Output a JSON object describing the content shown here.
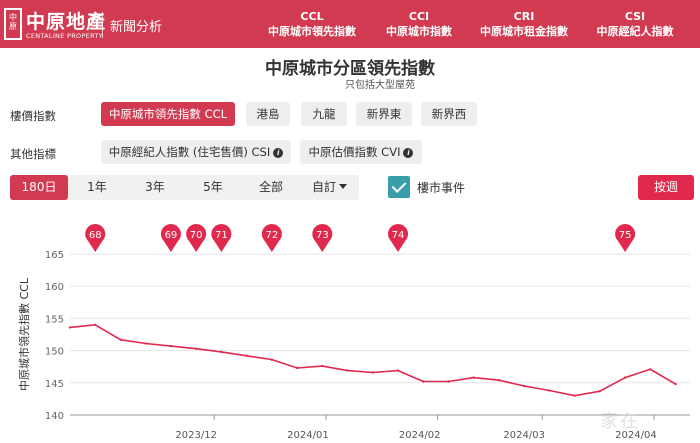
{
  "header": {
    "logo_mark": "中原",
    "logo_name": "中原地產",
    "logo_sub": "CENTALINE PROPERTY",
    "news_link": "新聞分析",
    "nav": [
      {
        "code": "CCL",
        "name": "中原城市領先指數"
      },
      {
        "code": "CCI",
        "name": "中原城市指數"
      },
      {
        "code": "CRI",
        "name": "中原城市租金指數"
      },
      {
        "code": "CSI",
        "name": "中原經紀人指數"
      }
    ]
  },
  "title": "中原城市分區領先指數",
  "subtitle": "只包括大型屋苑",
  "price_index": {
    "label": "樓價指數",
    "options": [
      "中原城市領先指數 CCL",
      "港島",
      "九龍",
      "新界東",
      "新界西"
    ],
    "selected": "中原城市領先指數 CCL"
  },
  "other_index": {
    "label": "其他指標",
    "options": [
      "中原經紀人指數 (住宅售價) CSI",
      "中原估價指數 CVI"
    ]
  },
  "range": {
    "options": [
      "180日",
      "1年",
      "3年",
      "5年",
      "全部",
      "自訂"
    ],
    "selected": "180日"
  },
  "events_toggle": {
    "label": "樓市事件",
    "checked": true
  },
  "search_button": "按週",
  "chart_data": {
    "type": "line",
    "ylabel": "中原城市領先指數 CCL",
    "ylim": [
      140,
      165
    ],
    "yticks": [
      "140",
      "145",
      "150",
      "155",
      "160",
      "165"
    ],
    "xticks": [
      {
        "label": "2023/12",
        "x": "2023-12-01"
      },
      {
        "label": "2024/01",
        "x": "2024-01-01"
      },
      {
        "label": "2024/02",
        "x": "2024-02-01"
      },
      {
        "label": "2024/03",
        "x": "2024-03-01"
      },
      {
        "label": "2024/04",
        "x": "2024-04-01"
      }
    ],
    "xlim": [
      "2023-10-22",
      "2024-04-11"
    ],
    "grid": true,
    "color": "#e0294d",
    "series": [
      {
        "points": [
          [
            "2023-10-22",
            153.6
          ],
          [
            "2023-10-29",
            154.0
          ],
          [
            "2023-11-05",
            151.7
          ],
          [
            "2023-11-12",
            151.1
          ],
          [
            "2023-11-19",
            150.7
          ],
          [
            "2023-11-26",
            150.3
          ],
          [
            "2023-12-03",
            149.8
          ],
          [
            "2023-12-10",
            149.2
          ],
          [
            "2023-12-17",
            148.6
          ],
          [
            "2023-12-24",
            147.3
          ],
          [
            "2023-12-31",
            147.6
          ],
          [
            "2024-01-07",
            146.9
          ],
          [
            "2024-01-14",
            146.6
          ],
          [
            "2024-01-21",
            146.9
          ],
          [
            "2024-01-28",
            145.2
          ],
          [
            "2024-02-04",
            145.2
          ],
          [
            "2024-02-11",
            145.8
          ],
          [
            "2024-02-18",
            145.4
          ],
          [
            "2024-02-25",
            144.5
          ],
          [
            "2024-03-03",
            143.8
          ],
          [
            "2024-03-10",
            143.0
          ],
          [
            "2024-03-17",
            143.7
          ],
          [
            "2024-03-24",
            145.8
          ],
          [
            "2024-03-31",
            147.1
          ],
          [
            "2024-04-07",
            144.8
          ]
        ]
      }
    ],
    "events": [
      {
        "label": "68",
        "x": "2023-10-29"
      },
      {
        "label": "69",
        "x": "2023-11-19"
      },
      {
        "label": "70",
        "x": "2023-11-26"
      },
      {
        "label": "71",
        "x": "2023-12-03"
      },
      {
        "label": "72",
        "x": "2023-12-17"
      },
      {
        "label": "73",
        "x": "2023-12-31"
      },
      {
        "label": "74",
        "x": "2024-01-21"
      },
      {
        "label": "75",
        "x": "2024-03-24"
      }
    ]
  },
  "watermark": "家在"
}
